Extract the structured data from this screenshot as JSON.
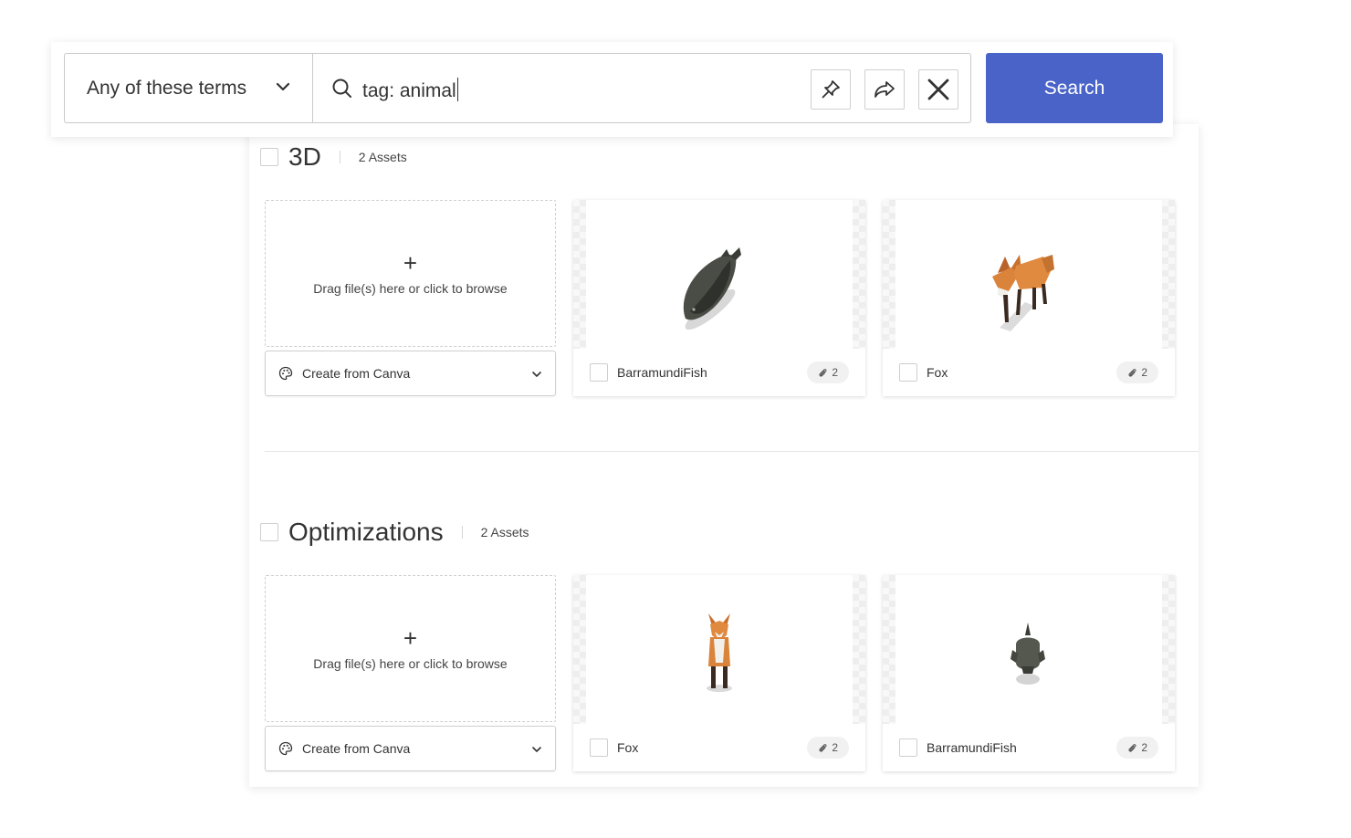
{
  "search": {
    "mode_label": "Any of these terms",
    "query": "tag: animal",
    "search_button": "Search"
  },
  "sections": [
    {
      "title": "3D",
      "count": "2 Assets",
      "dropzone_plus": "+",
      "dropzone_hint": "Drag file(s) here or click to browse",
      "canva_label": "Create from Canva",
      "cards": [
        {
          "name": "BarramundiFish",
          "badge": "2"
        },
        {
          "name": "Fox",
          "badge": "2"
        }
      ]
    },
    {
      "title": "Optimizations",
      "count": "2 Assets",
      "dropzone_plus": "+",
      "dropzone_hint": "Drag file(s) here or click to browse",
      "canva_label": "Create from Canva",
      "cards": [
        {
          "name": "Fox",
          "badge": "2"
        },
        {
          "name": "BarramundiFish",
          "badge": "2"
        }
      ]
    }
  ],
  "colors": {
    "accent": "#4a63c8"
  },
  "icons": [
    "chevron-down-icon",
    "search-icon",
    "pin-icon",
    "share-icon",
    "close-icon",
    "palette-icon",
    "paperclip-icon"
  ]
}
